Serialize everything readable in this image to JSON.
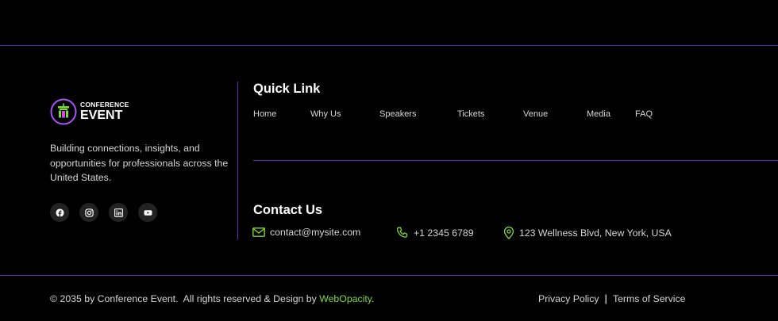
{
  "brand": {
    "top": "CONFERENCE",
    "bottom": "EVENT",
    "description": "Building connections, insights, and opportunities for professionals across the United States.",
    "accent_color": "#a855f7",
    "green_color": "#7dd83a"
  },
  "socials": [
    {
      "icon": "facebook-icon"
    },
    {
      "icon": "instagram-icon"
    },
    {
      "icon": "linkedin-icon"
    },
    {
      "icon": "youtube-icon"
    }
  ],
  "quick_links": {
    "title": "Quick Link",
    "items": [
      "Home",
      "Why Us",
      "Speakers",
      "Tickets",
      "Venue",
      "Media",
      "FAQ"
    ]
  },
  "contact": {
    "title": "Contact Us",
    "email": "contact@mysite.com",
    "phone": "+1 2345 6789",
    "address": "123 Wellness Blvd, New York, USA"
  },
  "footer": {
    "copyright": "© 2035 by Conference Event.  All rights reserved & Design by ",
    "designer": "WebOpacity",
    "period": ".",
    "privacy": "Privacy Policy",
    "separator": "|",
    "terms": "Terms of Service"
  }
}
